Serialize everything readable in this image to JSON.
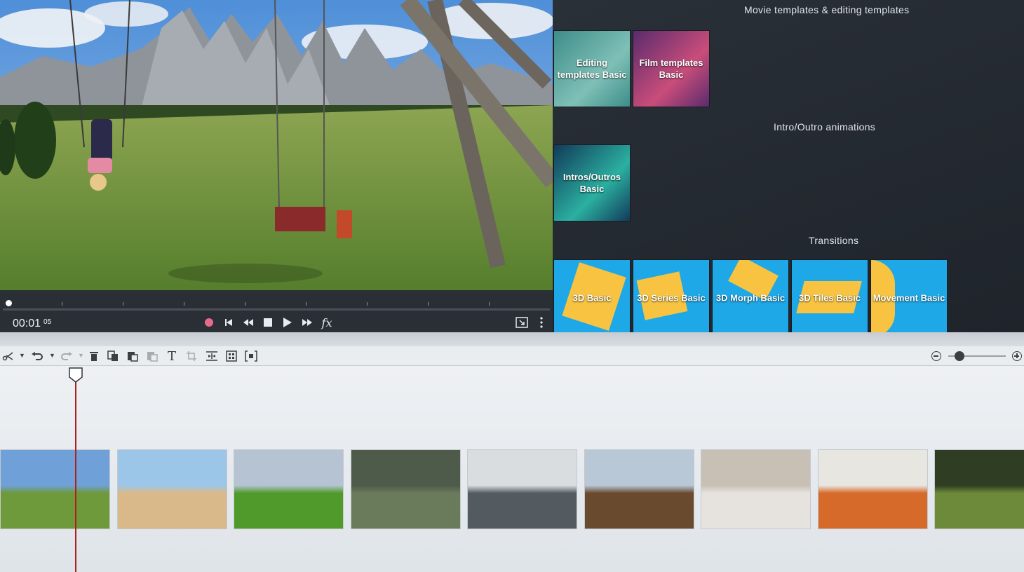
{
  "preview": {
    "timecode": "00:01",
    "timecode_frames": "05",
    "scene_description_icon": "swing-scene-image",
    "transport": {
      "record_icon": "record-icon",
      "prev_icon": "skip-back-icon",
      "rewind_icon": "rewind-icon",
      "stop_icon": "stop-icon",
      "play_icon": "play-icon",
      "forward_icon": "fast-forward-icon",
      "fx_label": "fx",
      "fullscreen_icon": "fullscreen-icon",
      "more_icon": "more-icon"
    },
    "colors": {
      "record": "#e86a8a"
    }
  },
  "templates": {
    "sections": [
      {
        "title": "Movie templates & editing templates",
        "tiles": [
          {
            "label": "Editing templates Basic",
            "colors": [
              "#3d8d8a",
              "#7fc0b6"
            ]
          },
          {
            "label": "Film templates Basic",
            "colors": [
              "#5a2b6d",
              "#c94d7a"
            ]
          }
        ]
      },
      {
        "title": "Intro/Outro animations",
        "tiles": [
          {
            "label": "Intros/Outros Basic",
            "colors": [
              "#123a5a",
              "#2bb0a0"
            ]
          }
        ]
      },
      {
        "title": "Transitions",
        "tiles": [
          {
            "label": "3D Basic",
            "colors": [
              "#1ea8e8",
              "#f7c341"
            ]
          },
          {
            "label": "3D Series Basic",
            "colors": [
              "#1ea8e8",
              "#f7c341"
            ]
          },
          {
            "label": "3D Morph Basic",
            "colors": [
              "#1ea8e8",
              "#f7c341"
            ]
          },
          {
            "label": "3D Tiles Basic",
            "colors": [
              "#1ea8e8",
              "#f7c341"
            ]
          },
          {
            "label": "Movement Basic",
            "colors": [
              "#1ea8e8",
              "#f7c341"
            ]
          }
        ]
      }
    ]
  },
  "toolbar": {
    "icons": [
      "scissors-icon",
      "undo-icon",
      "redo-icon",
      "delete-icon",
      "copy-icon",
      "paste-icon",
      "paste-disabled-icon",
      "text-icon",
      "crop-icon",
      "split-icon",
      "grid-icon",
      "fit-icon"
    ],
    "text_tool_label": "T",
    "zoom_level": 0.2
  },
  "timeline": {
    "clips": [
      {
        "name": "swing-clip",
        "colors": [
          "#6fa1d8",
          "#6e9a3c"
        ]
      },
      {
        "name": "beach-dog-clip",
        "colors": [
          "#9cc6e8",
          "#d9b98a"
        ]
      },
      {
        "name": "mountain-meadow-clip",
        "colors": [
          "#b5c3d3",
          "#4f9a2a"
        ]
      },
      {
        "name": "couple-field-clip",
        "colors": [
          "#4e5a4a",
          "#6a7b5c"
        ]
      },
      {
        "name": "city-binoculars-clip",
        "colors": [
          "#d9dde0",
          "#535a60"
        ]
      },
      {
        "name": "volcano-mountain-clip",
        "colors": [
          "#b9c8d6",
          "#6a4a2e"
        ]
      },
      {
        "name": "staircase-clip",
        "colors": [
          "#c9c0b5",
          "#e6e3df"
        ]
      },
      {
        "name": "monks-temple-clip",
        "colors": [
          "#e8e6e0",
          "#d66a2a"
        ]
      },
      {
        "name": "hands-plant-clip",
        "colors": [
          "#2f3d22",
          "#6d8a3a"
        ]
      }
    ],
    "playhead_color": "#b01e1e"
  }
}
